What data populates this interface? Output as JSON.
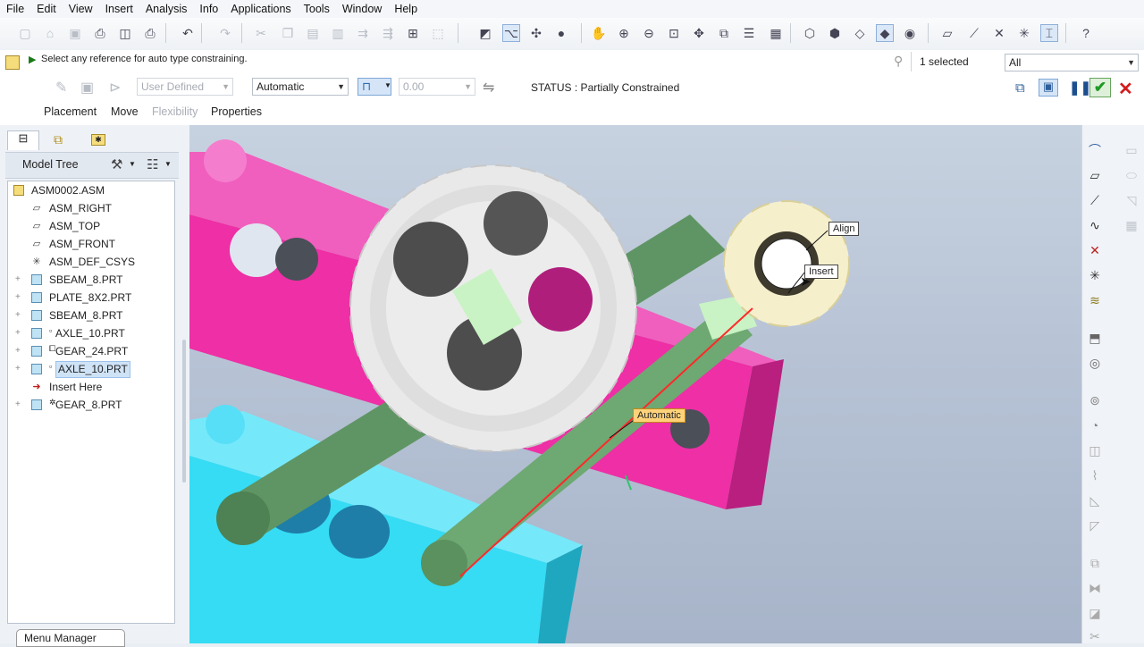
{
  "menu": [
    "File",
    "Edit",
    "View",
    "Insert",
    "Analysis",
    "Info",
    "Applications",
    "Tools",
    "Window",
    "Help"
  ],
  "toolbar_icons": [
    {
      "name": "new-file-icon",
      "glyph": "▢",
      "dim": true
    },
    {
      "name": "open-file-icon",
      "glyph": "⌂",
      "dim": true
    },
    {
      "name": "save-icon",
      "glyph": "▣",
      "dim": true
    },
    {
      "name": "print-icon",
      "glyph": "⎙",
      "dim": false
    },
    {
      "name": "print-preview-icon",
      "glyph": "◫",
      "dim": false
    },
    {
      "name": "quick-print-icon",
      "glyph": "⎙",
      "dim": false
    },
    {
      "name": "undo-icon",
      "glyph": "↶",
      "dim": false
    },
    {
      "name": "redo-icon",
      "glyph": "↷",
      "dim": true
    },
    {
      "name": "cut-icon",
      "glyph": "✂",
      "dim": true
    },
    {
      "name": "copy-icon",
      "glyph": "❐",
      "dim": true
    },
    {
      "name": "paste-icon",
      "glyph": "▤",
      "dim": true
    },
    {
      "name": "paste-special-icon",
      "glyph": "▥",
      "dim": true
    },
    {
      "name": "mirror-icon",
      "glyph": "⇉",
      "dim": true
    },
    {
      "name": "regenerate-icon",
      "glyph": "⇶",
      "dim": true
    },
    {
      "name": "binoculars-icon",
      "glyph": "⊞",
      "dim": false
    },
    {
      "name": "select-box-icon",
      "glyph": "⬚",
      "dim": true
    },
    {
      "name": "sketch-view-icon",
      "glyph": "◩",
      "dim": false
    },
    {
      "name": "datum-display-icon",
      "glyph": "⌥",
      "dim": false
    },
    {
      "name": "spin-center-icon",
      "glyph": "✣",
      "dim": false
    },
    {
      "name": "shading-icon",
      "glyph": "●",
      "dim": false
    },
    {
      "name": "pan-hand-icon",
      "glyph": "✋",
      "dim": false
    },
    {
      "name": "zoom-in-icon",
      "glyph": "⊕",
      "dim": false
    },
    {
      "name": "zoom-out-icon",
      "glyph": "⊖",
      "dim": false
    },
    {
      "name": "refit-icon",
      "glyph": "⊡",
      "dim": false
    },
    {
      "name": "reorient-icon",
      "glyph": "✥",
      "dim": false
    },
    {
      "name": "saved-views-icon",
      "glyph": "⧉",
      "dim": false
    },
    {
      "name": "layers-icon",
      "glyph": "☰",
      "dim": false
    },
    {
      "name": "appearance-icon",
      "glyph": "▦",
      "dim": false
    },
    {
      "name": "wireframe-icon",
      "glyph": "⬡",
      "dim": false
    },
    {
      "name": "hidden-line-icon",
      "glyph": "⬢",
      "dim": false
    },
    {
      "name": "no-hidden-icon",
      "glyph": "◇",
      "dim": false
    },
    {
      "name": "shaded-icon",
      "glyph": "◆",
      "dim": false
    },
    {
      "name": "enhanced-realism-icon",
      "glyph": "◉",
      "dim": false
    },
    {
      "name": "datum-planes-icon",
      "glyph": "▱",
      "dim": false
    },
    {
      "name": "datum-axes-icon",
      "glyph": "⟋",
      "dim": false
    },
    {
      "name": "datum-points-icon",
      "glyph": "✕",
      "dim": false
    },
    {
      "name": "coordinate-systems-icon",
      "glyph": "✳",
      "dim": false
    },
    {
      "name": "annotation-display-icon",
      "glyph": "⌶",
      "dim": false
    },
    {
      "name": "context-help-icon",
      "glyph": "?",
      "dim": false
    }
  ],
  "dashboard": {
    "message": "Select any reference for auto type constraining.",
    "selected_count": "1 selected",
    "filter": "All",
    "user_defined": "User Defined",
    "constraint_type": "Automatic",
    "offset_value": "0.00",
    "status": "STATUS : Partially Constrained",
    "tabs": [
      {
        "label": "Placement",
        "enabled": true
      },
      {
        "label": "Move",
        "enabled": true
      },
      {
        "label": "Flexibility",
        "enabled": false
      },
      {
        "label": "Properties",
        "enabled": true
      }
    ]
  },
  "model_tree": {
    "title": "Model Tree",
    "items": [
      {
        "label": "ASM0002.ASM",
        "kind": "asm",
        "expandable": false,
        "depth": 0,
        "marker": ""
      },
      {
        "label": "ASM_RIGHT",
        "kind": "plane",
        "expandable": false,
        "depth": 1,
        "marker": ""
      },
      {
        "label": "ASM_TOP",
        "kind": "plane",
        "expandable": false,
        "depth": 1,
        "marker": ""
      },
      {
        "label": "ASM_FRONT",
        "kind": "plane",
        "expandable": false,
        "depth": 1,
        "marker": ""
      },
      {
        "label": "ASM_DEF_CSYS",
        "kind": "csys",
        "expandable": false,
        "depth": 1,
        "marker": ""
      },
      {
        "label": "SBEAM_8.PRT",
        "kind": "part",
        "expandable": true,
        "depth": 1,
        "marker": ""
      },
      {
        "label": "PLATE_8X2.PRT",
        "kind": "part",
        "expandable": true,
        "depth": 1,
        "marker": ""
      },
      {
        "label": "SBEAM_8.PRT",
        "kind": "part",
        "expandable": true,
        "depth": 1,
        "marker": ""
      },
      {
        "label": "AXLE_10.PRT",
        "kind": "part",
        "expandable": true,
        "depth": 1,
        "marker": "▫"
      },
      {
        "label": "GEAR_24.PRT",
        "kind": "part",
        "expandable": true,
        "depth": 1,
        "marker": "⧠"
      },
      {
        "label": "AXLE_10.PRT",
        "kind": "part",
        "expandable": true,
        "depth": 1,
        "marker": "▫",
        "selected": true
      },
      {
        "label": "Insert Here",
        "kind": "insert",
        "expandable": false,
        "depth": 1,
        "marker": ""
      },
      {
        "label": "GEAR_8.PRT",
        "kind": "part",
        "expandable": true,
        "depth": 1,
        "marker": "✲"
      }
    ]
  },
  "viewport_labels": {
    "align": "Align",
    "insert": "Insert",
    "automatic": "Automatic"
  },
  "menu_manager": "Menu Manager",
  "colors": {
    "magenta_beam": "#ee2fa5",
    "cyan_beam": "#35dcf4",
    "axle_green": "#66a06a",
    "big_gear": "#e9e9e9",
    "small_gear": "#f5efcc",
    "constraint_line": "#ff2a2a",
    "tag_orange": "#ffd27a"
  }
}
